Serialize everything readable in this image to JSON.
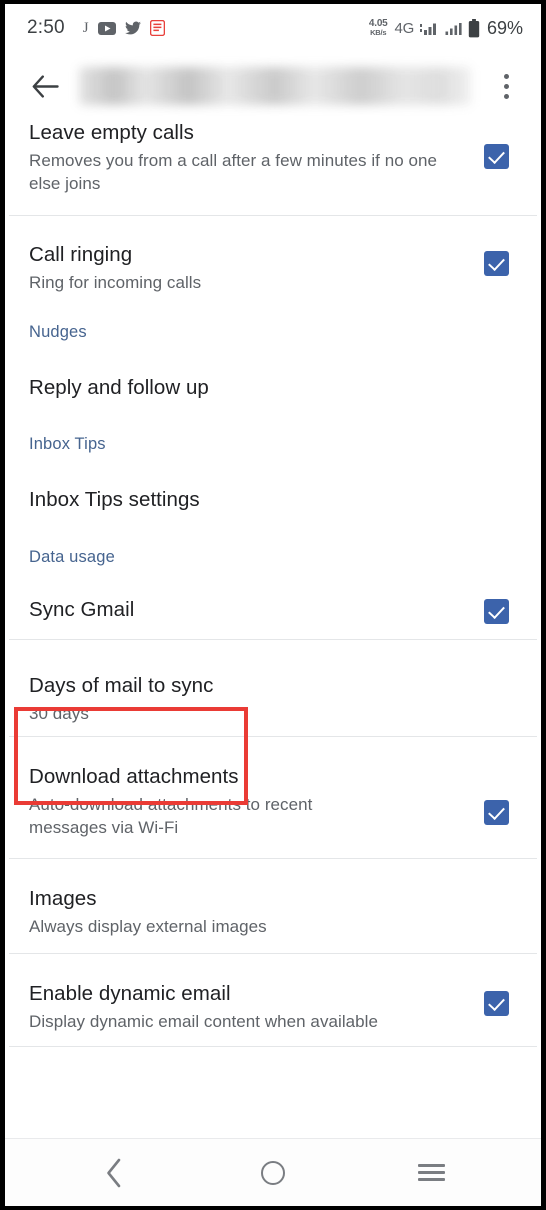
{
  "status_bar": {
    "clock": "2:50",
    "left_icons": [
      "music-app-icon",
      "youtube-icon",
      "twitter-icon",
      "news-app-icon"
    ],
    "net_speed_value": "4.05",
    "net_speed_unit": "KB/s",
    "network_type": "4G",
    "signal_icons": [
      "signal-sim1-icon",
      "signal-sim2-icon"
    ],
    "battery_icon": "battery-icon",
    "battery_percent": "69%"
  },
  "app_bar": {
    "back_icon": "back-arrow-icon",
    "title": "",
    "title_redacted": true,
    "overflow_icon": "overflow-menu-icon"
  },
  "settings": {
    "items": [
      {
        "kind": "row",
        "name": "leave-empty-calls",
        "title": "Leave empty calls",
        "subtitle": "Removes you from a call after a few minutes if no one else joins",
        "checkbox": true,
        "checked": true,
        "clipped_top": true
      },
      {
        "kind": "row",
        "name": "call-ringing",
        "title": "Call ringing",
        "subtitle": "Ring for incoming calls",
        "checkbox": true,
        "checked": true
      },
      {
        "kind": "header",
        "name": "nudges",
        "title": "Nudges"
      },
      {
        "kind": "row",
        "name": "reply-and-follow-up",
        "title": "Reply and follow up",
        "subtitle": "",
        "checkbox": false
      },
      {
        "kind": "header",
        "name": "inbox-tips",
        "title": "Inbox Tips"
      },
      {
        "kind": "row",
        "name": "inbox-tips-settings",
        "title": "Inbox Tips settings",
        "subtitle": "",
        "checkbox": false
      },
      {
        "kind": "header",
        "name": "data-usage",
        "title": "Data usage"
      },
      {
        "kind": "row",
        "name": "sync-gmail",
        "title": "Sync Gmail",
        "subtitle": "",
        "checkbox": true,
        "checked": true
      },
      {
        "kind": "row",
        "name": "days-of-mail-to-sync",
        "title": "Days of mail to sync",
        "subtitle": "30 days",
        "checkbox": false,
        "highlighted": true
      },
      {
        "kind": "row",
        "name": "download-attachments",
        "title": "Download attachments",
        "subtitle": "Auto-download attachments to recent messages via Wi-Fi",
        "checkbox": true,
        "checked": true
      },
      {
        "kind": "row",
        "name": "images",
        "title": "Images",
        "subtitle": "Always display external images",
        "checkbox": false
      },
      {
        "kind": "row",
        "name": "enable-dynamic-email",
        "title": "Enable dynamic email",
        "subtitle": "Display dynamic email content when available",
        "checkbox": true,
        "checked": true
      }
    ]
  },
  "annotation": {
    "target": "days-of-mail-to-sync",
    "color": "#ea3b35",
    "shape": "rectangle"
  },
  "nav_bar": {
    "back_icon": "nav-back-icon",
    "home_icon": "nav-home-icon",
    "recents_icon": "nav-recents-icon"
  },
  "colors": {
    "checkbox_blue": "#3c63ab",
    "section_header_blue": "#46648f",
    "title_text": "#202124",
    "subtitle_text": "#5f6368",
    "annotation_red": "#ea3b35",
    "divider": "#e4e6e8"
  }
}
